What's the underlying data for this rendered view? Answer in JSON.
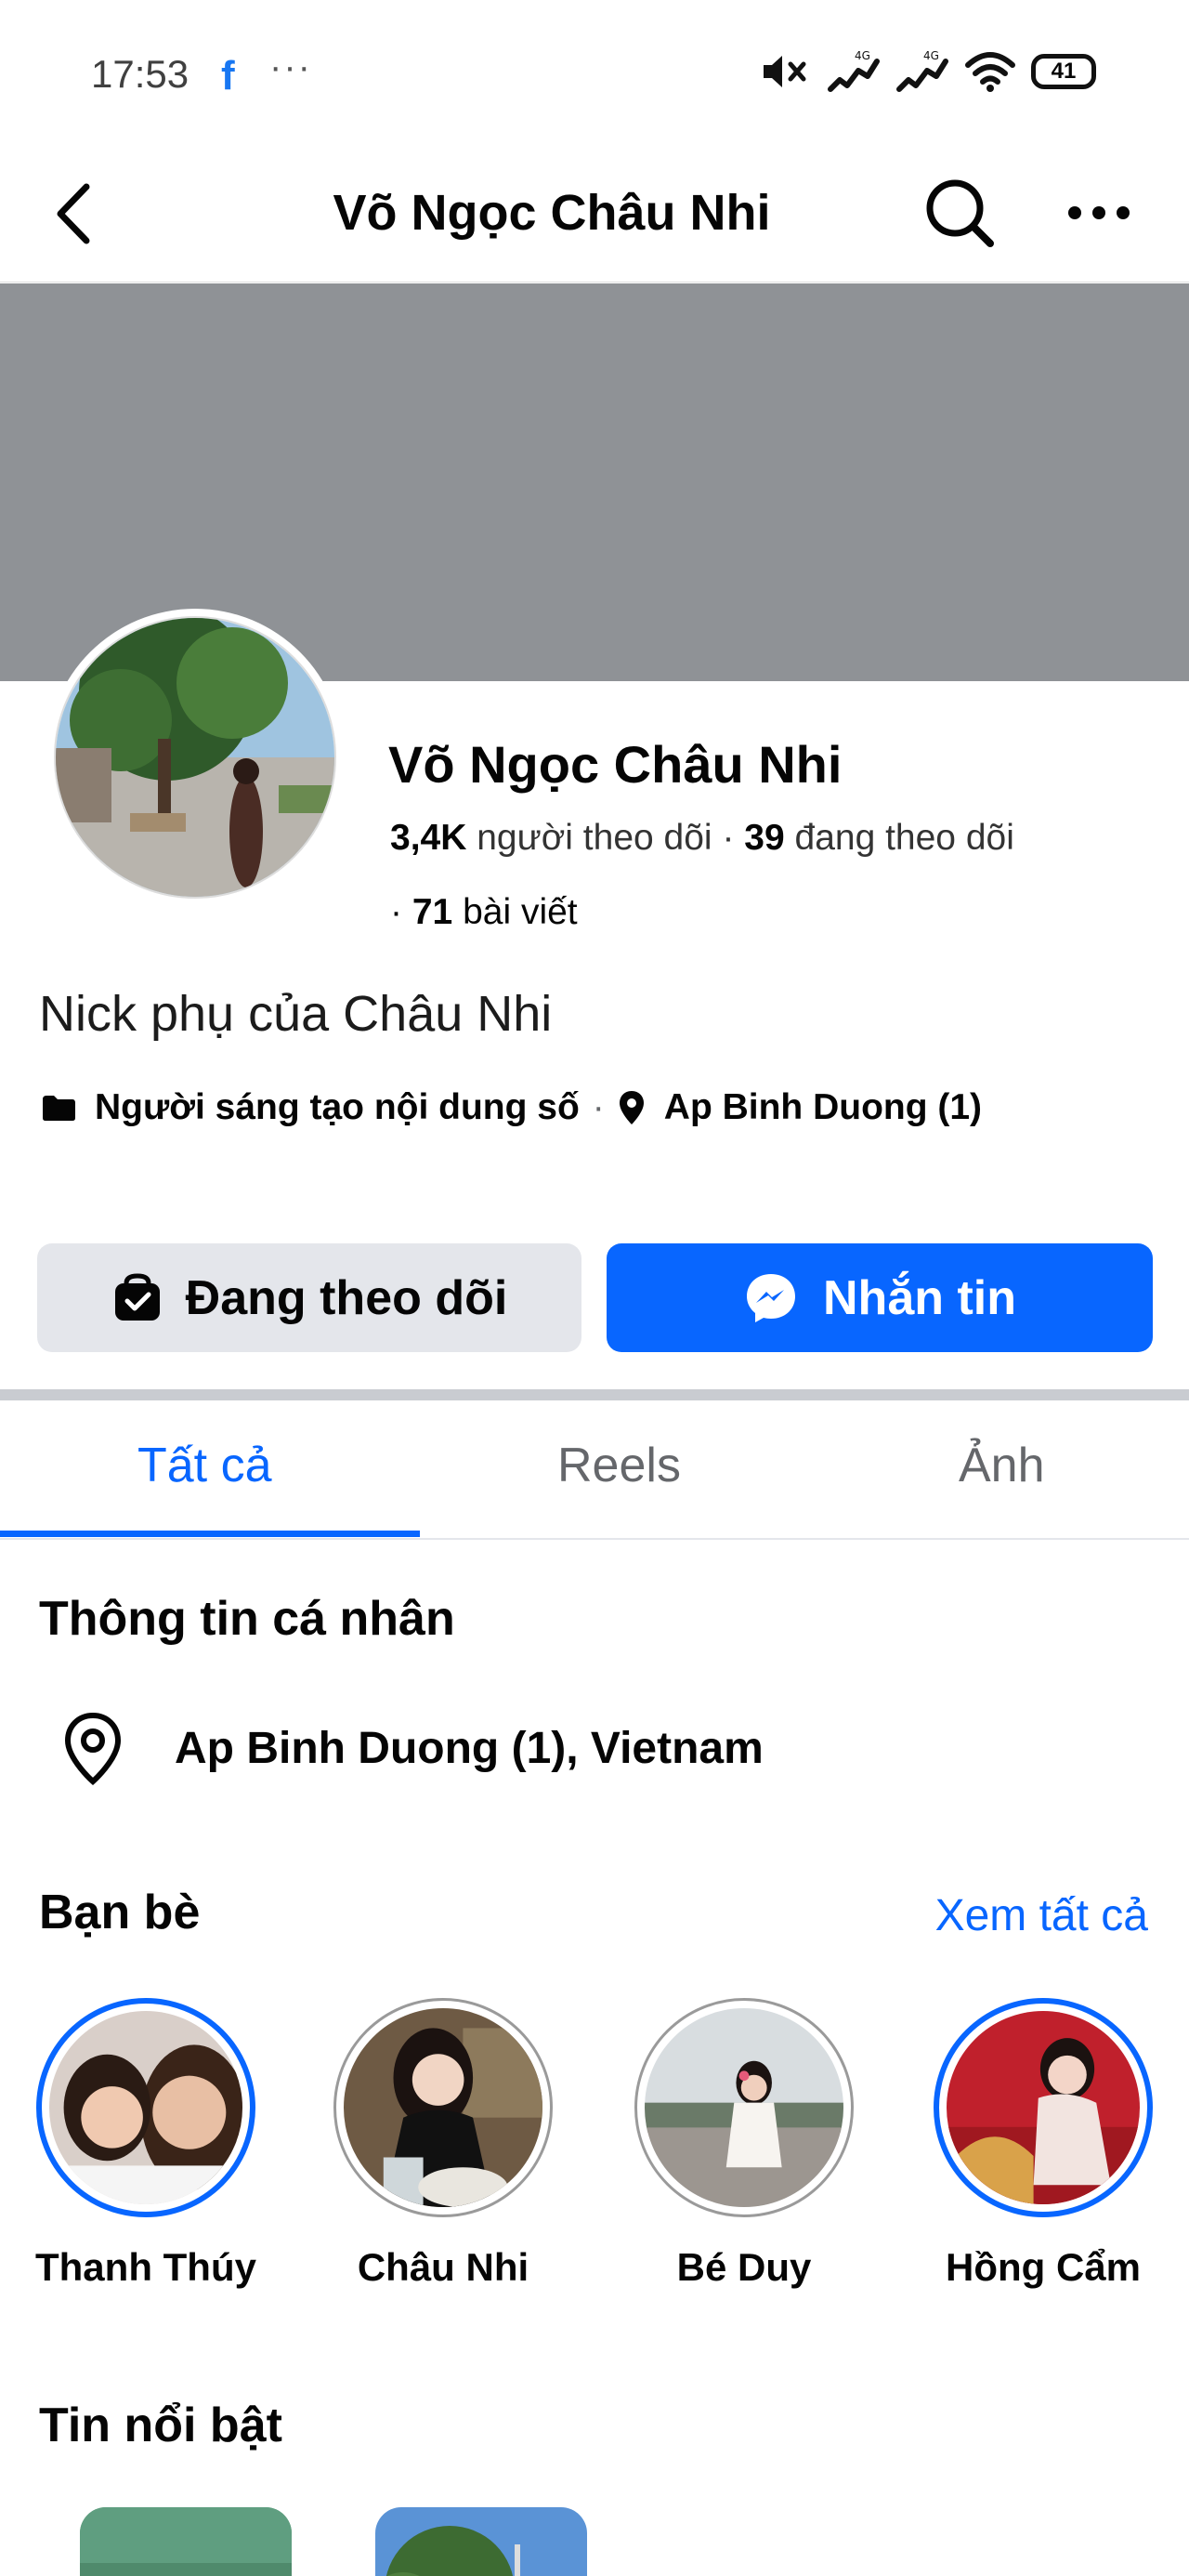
{
  "status_bar": {
    "time": "17:53",
    "app_icon": "facebook-icon",
    "overflow": "···",
    "icons": [
      "mute-icon",
      "signal-4g-icon",
      "signal-4g-icon",
      "wifi-icon"
    ],
    "battery": "41"
  },
  "header": {
    "title": "Võ Ngọc Châu Nhi",
    "back_icon": "chevron-left-icon",
    "search_icon": "search-icon",
    "more_icon": "more-horizontal-icon"
  },
  "profile": {
    "name": "Võ Ngọc Châu Nhi",
    "followers_count": "3,4K",
    "followers_label": "người theo dõi",
    "following_count": "39",
    "following_label": "đang theo dõi",
    "posts_count": "71",
    "posts_label": "bài viết",
    "bio": "Nick phụ của Châu Nhi",
    "category": "Người sáng tạo nội dung số",
    "location": "Ap Binh Duong (1)"
  },
  "actions": {
    "following_label": "Đang theo dõi",
    "message_label": "Nhắn tin"
  },
  "tabs": [
    {
      "label": "Tất cả",
      "active": true
    },
    {
      "label": "Reels",
      "active": false
    },
    {
      "label": "Ảnh",
      "active": false
    }
  ],
  "personal_info": {
    "heading": "Thông tin cá nhân",
    "location": "Ap Binh Duong (1), Vietnam"
  },
  "friends": {
    "heading": "Bạn bè",
    "see_all": "Xem tất cả",
    "items": [
      {
        "name": "Thanh Thúy"
      },
      {
        "name": "Châu Nhi"
      },
      {
        "name": "Bé Duy"
      },
      {
        "name": "Hồng Cẩm"
      }
    ]
  },
  "highlights": {
    "heading": "Tin nổi bật"
  },
  "colors": {
    "accent": "#0866ff",
    "cover": "#8f9296",
    "secondary_button": "#e4e6eb"
  }
}
